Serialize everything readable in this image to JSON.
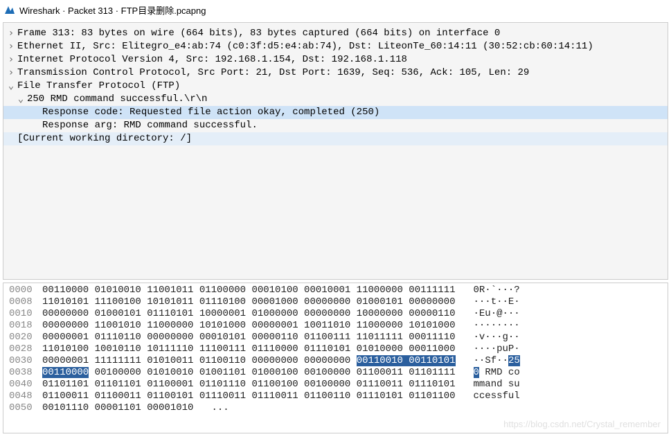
{
  "title": "Wireshark · Packet 313 · FTP目录删除.pcapng",
  "tree": {
    "frame": "Frame 313: 83 bytes on wire (664 bits), 83 bytes captured (664 bits) on interface 0",
    "eth": "Ethernet II, Src: Elitegro_e4:ab:74 (c0:3f:d5:e4:ab:74), Dst: LiteonTe_60:14:11 (30:52:cb:60:14:11)",
    "ip": "Internet Protocol Version 4, Src: 192.168.1.154, Dst: 192.168.1.118",
    "tcp": "Transmission Control Protocol, Src Port: 21, Dst Port: 1639, Seq: 536, Ack: 105, Len: 29",
    "ftp": "File Transfer Protocol (FTP)",
    "ftp_resp": "250 RMD command successful.\\r\\n",
    "resp_code": "Response code: Requested file action okay, completed (250)",
    "resp_arg": "Response arg: RMD command successful.",
    "cwd": "[Current working directory: /]"
  },
  "hex": {
    "rows": [
      {
        "off": "0000",
        "b": "00110000 01010010 11001011 01100000 00010100 00010001 11000000 00111111",
        "a": "0R·`···?"
      },
      {
        "off": "0008",
        "b": "11010101 11100100 10101011 01110100 00001000 00000000 01000101 00000000",
        "a": "···t··E·"
      },
      {
        "off": "0010",
        "b": "00000000 01000101 01110101 10000001 01000000 00000000 10000000 00000110",
        "a": "·Eu·@···"
      },
      {
        "off": "0018",
        "b": "00000000 11001010 11000000 10101000 00000001 10011010 11000000 10101000",
        "a": "········"
      },
      {
        "off": "0020",
        "b": "00000001 01110110 00000000 00010101 00000110 01100111 11011111 00011110",
        "a": "·v···g··"
      },
      {
        "off": "0028",
        "b": "11010100 10010110 10111110 11100111 01110000 01110101 01010000 00011000",
        "a": "····puP·"
      },
      {
        "off": "0030",
        "b": "00000001 11111111 01010011 01100110 00000000 00000000 ",
        "bhl": "00110010 00110101",
        "a": "··Sf··",
        "ahl": "25"
      },
      {
        "off": "0038",
        "bhl2": "00110000",
        "b": " 00100000 01010010 01001101 01000100 00100000 01100011 01101111",
        "ahl2": "0",
        "a": " RMD co"
      },
      {
        "off": "0040",
        "b": "01101101 01101101 01100001 01101110 01100100 00100000 01110011 01110101",
        "a": "mmand su"
      },
      {
        "off": "0048",
        "b": "01100011 01100011 01100101 01110011 01110011 01100110 01110101 01101100",
        "a": "ccessful"
      },
      {
        "off": "0050",
        "b": "00101110 00001101 00001010",
        "a": "..."
      }
    ]
  },
  "watermark": "https://blog.csdn.net/Crystal_remember"
}
